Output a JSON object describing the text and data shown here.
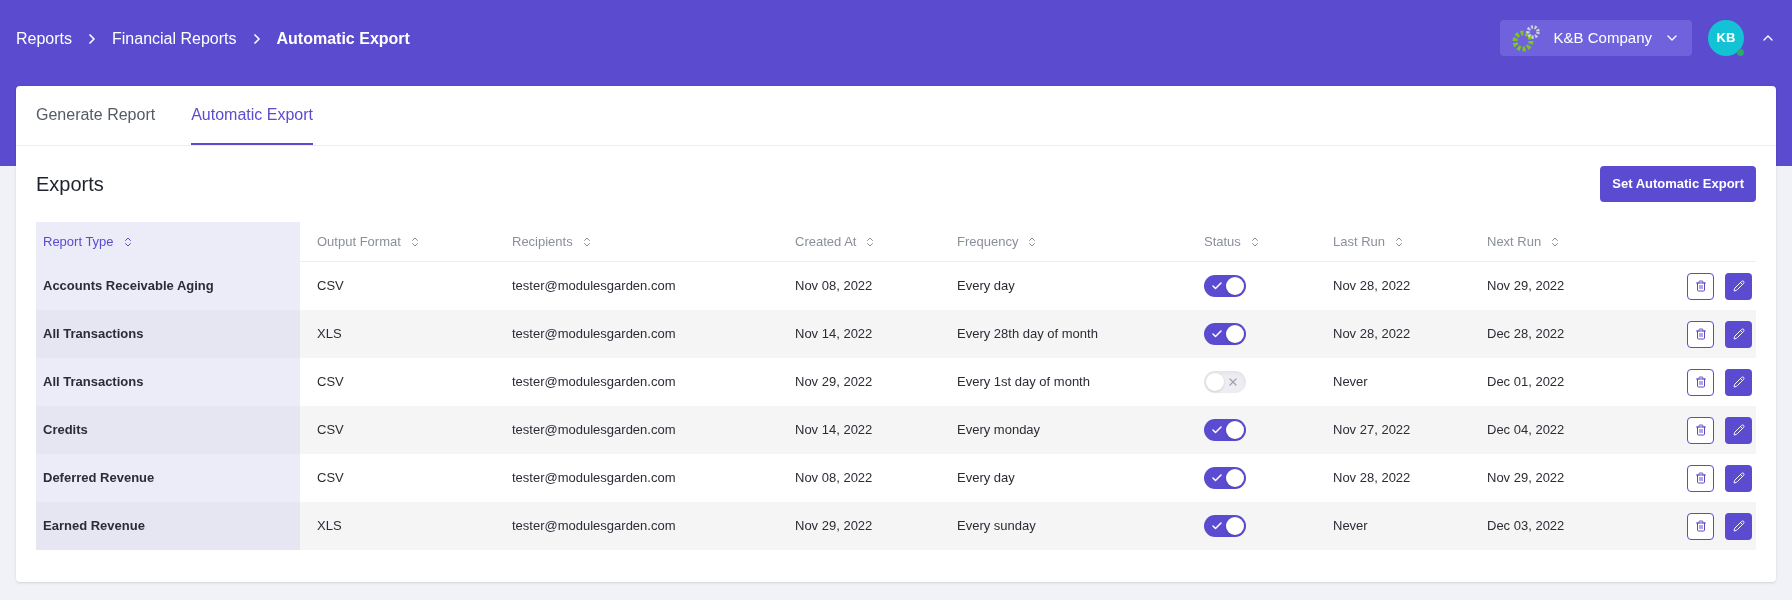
{
  "breadcrumbs": [
    "Reports",
    "Financial Reports",
    "Automatic Export"
  ],
  "company": {
    "name": "K&B Company"
  },
  "user": {
    "initials": "KB",
    "online": true
  },
  "tabs": [
    {
      "label": "Generate Report",
      "selected": false
    },
    {
      "label": "Automatic Export",
      "selected": true
    }
  ],
  "section": {
    "title": "Exports",
    "action": "Set Automatic Export"
  },
  "table": {
    "columns": [
      {
        "label": "Report Type",
        "selected": true
      },
      {
        "label": "Output Format",
        "selected": false
      },
      {
        "label": "Recipients",
        "selected": false
      },
      {
        "label": "Created At",
        "selected": false
      },
      {
        "label": "Frequency",
        "selected": false
      },
      {
        "label": "Status",
        "selected": false
      },
      {
        "label": "Last Run",
        "selected": false
      },
      {
        "label": "Next Run",
        "selected": false
      }
    ],
    "rows": [
      {
        "report_type": "Accounts Receivable Aging",
        "format": "CSV",
        "recipients": "tester@modulesgarden.com",
        "created": "Nov 08, 2022",
        "frequency": "Every day",
        "on": true,
        "last_run": "Nov 28, 2022",
        "next_run": "Nov 29, 2022"
      },
      {
        "report_type": "All Transactions",
        "format": "XLS",
        "recipients": "tester@modulesgarden.com",
        "created": "Nov 14, 2022",
        "frequency": "Every 28th day of month",
        "on": true,
        "last_run": "Nov 28, 2022",
        "next_run": "Dec 28, 2022"
      },
      {
        "report_type": "All Transactions",
        "format": "CSV",
        "recipients": "tester@modulesgarden.com",
        "created": "Nov 29, 2022",
        "frequency": "Every 1st day of month",
        "on": false,
        "last_run": "Never",
        "next_run": "Dec 01, 2022"
      },
      {
        "report_type": "Credits",
        "format": "CSV",
        "recipients": "tester@modulesgarden.com",
        "created": "Nov 14, 2022",
        "frequency": "Every monday",
        "on": true,
        "last_run": "Nov 27, 2022",
        "next_run": "Dec 04, 2022"
      },
      {
        "report_type": "Deferred Revenue",
        "format": "CSV",
        "recipients": "tester@modulesgarden.com",
        "created": "Nov 08, 2022",
        "frequency": "Every day",
        "on": true,
        "last_run": "Nov 28, 2022",
        "next_run": "Nov 29, 2022"
      },
      {
        "report_type": "Earned Revenue",
        "format": "XLS",
        "recipients": "tester@modulesgarden.com",
        "created": "Nov 29, 2022",
        "frequency": "Every sunday",
        "on": true,
        "last_run": "Never",
        "next_run": "Dec 03, 2022"
      }
    ]
  }
}
